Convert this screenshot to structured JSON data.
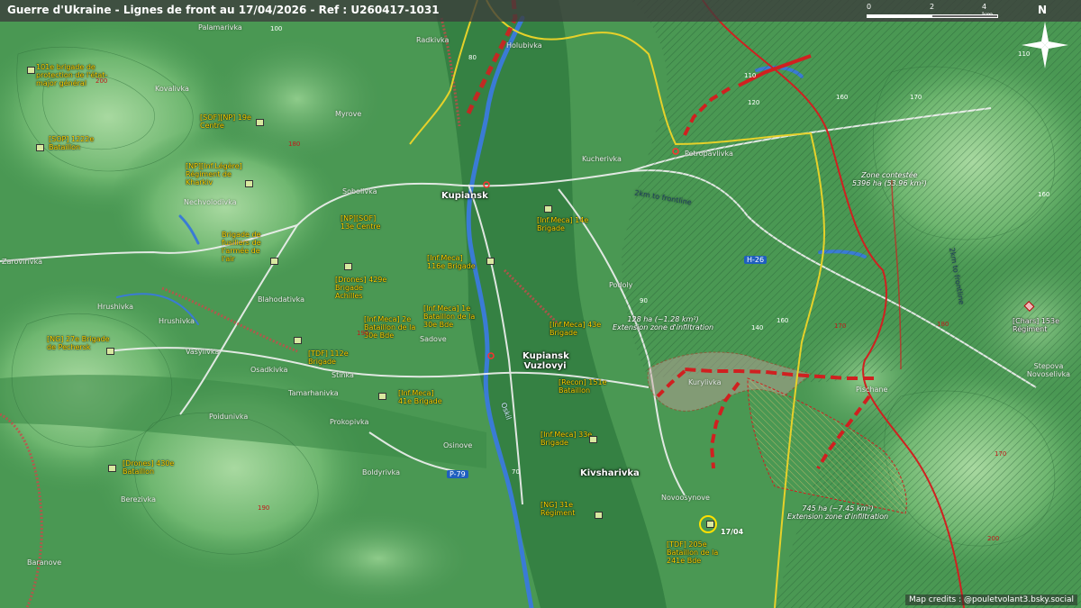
{
  "header": {
    "title": "Guerre d'Ukraine - Lignes de front au 17/04/2026 - Ref : U260417-1031",
    "scale_labels": [
      "0",
      "2",
      "4 km"
    ],
    "north_label": "N"
  },
  "credits": "Map credits : @pouletvolant3.bsky.social",
  "colors": {
    "relief_low": "#2f7a3e",
    "relief_mid": "#4f9e58",
    "relief_high": "#8ec98b",
    "ukraine_line": "#e6d12a",
    "russia_line": "#d02020",
    "road": "#f2f2f2",
    "water": "#3a7bd5"
  },
  "settlements": [
    "Palamarivka",
    "Radkivka",
    "Holubivka",
    "Kovalivka",
    "Myrove",
    "Kucherivka",
    "Petropavlivka",
    "Sobolivka",
    "Nechvolodivka",
    "Zarovirivka",
    "Hrushivka",
    "Hrushivka",
    "Blahodativka",
    "Vasylivka",
    "Osadkivka",
    "Sadove",
    "Podoly",
    "Kurylivka",
    "Pischane",
    "Stepova Novoselivka",
    "Stinka",
    "Tamarhanivka",
    "Poidunivka",
    "Prokopivka",
    "Osinove",
    "Boldyrivka",
    "Berezivka",
    "Baranove",
    "Novoosynove"
  ],
  "cities": [
    "Kupiansk",
    "Kupiansk Vuzlovyi",
    "Kivsharivka"
  ],
  "road_labels": [
    "H-26",
    "P-79"
  ],
  "river_label": "Oskil",
  "frontline_note_1": "2km to frontline",
  "frontline_note_2": "2km to frontline",
  "units": [
    {
      "text": "101e brigade de protection de l'état-major général"
    },
    {
      "text": "[SOF][NP] 19e Centre"
    },
    {
      "text": "[SOP] 1222e Bataillon"
    },
    {
      "text": "[NP][Inf.Légère] Régiment de Kharkiv"
    },
    {
      "text": "[NP][SOF] 13e Centre"
    },
    {
      "text": "Brigade de fusiliers de l'armée de l'air"
    },
    {
      "text": "[Drones] 429e Brigade Achilles"
    },
    {
      "text": "[Inf.Meca] 14e Brigade"
    },
    {
      "text": "[Inf.Meca] 116e Brigade"
    },
    {
      "text": "[Inf.Meca] 2e Bataillon de la 30e Bde"
    },
    {
      "text": "[Inf.Meca] 1e Bataillon de la 30e Bde"
    },
    {
      "text": "[Inf.Meca] 43e Brigade"
    },
    {
      "text": "[NG] 27e Brigade de Pechersk"
    },
    {
      "text": "[TDF] 112e Brigade"
    },
    {
      "text": "[Inf.Meca] 41e Brigade"
    },
    {
      "text": "[Recon] 151e Bataillon"
    },
    {
      "text": "[Inf.Meca] 33e Brigade"
    },
    {
      "text": "[Drones] 430e Bataillon"
    },
    {
      "text": "[NG] 31e Régiment"
    },
    {
      "text": "[TDF] 205e Bataillon de la 241e Bde"
    },
    {
      "text": "[Chars] 153e Régiment"
    }
  ],
  "zones": [
    {
      "area": "Zone contestée",
      "size": "5396 ha (53.96 km²)"
    },
    {
      "area": "128 ha (~1.28 km²)",
      "size": "Extension zone d'infiltration"
    },
    {
      "area": "745 ha (~7.45 km²)",
      "size": "Extension zone d'infiltration"
    }
  ],
  "date_marker": "17/04",
  "elevations": [
    "100",
    "80",
    "200",
    "180",
    "110",
    "120",
    "160",
    "170",
    "90",
    "140",
    "160",
    "170",
    "180",
    "190",
    "190",
    "160",
    "170",
    "200",
    "70",
    "110"
  ]
}
